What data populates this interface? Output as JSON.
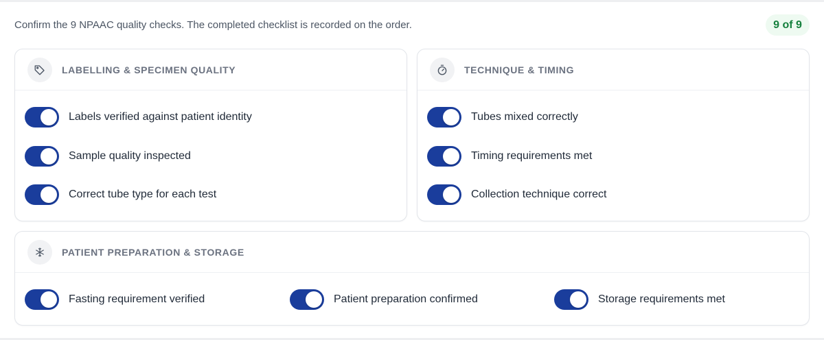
{
  "intro_text": "Confirm the 9 NPAAC quality checks. The completed checklist is recorded on the order.",
  "progress_badge": "9 of 9",
  "colors": {
    "toggle_on": "#1a3d9c",
    "badge_text": "#15803d",
    "badge_bg": "#eefaf1"
  },
  "sections": [
    {
      "icon": "tag-icon",
      "title": "LABELLING & SPECIMEN QUALITY",
      "items": [
        {
          "label": "Labels verified against patient identity",
          "checked": true
        },
        {
          "label": "Sample quality inspected",
          "checked": true
        },
        {
          "label": "Correct tube type for each test",
          "checked": true
        }
      ]
    },
    {
      "icon": "stopwatch-icon",
      "title": "TECHNIQUE & TIMING",
      "items": [
        {
          "label": "Tubes mixed correctly",
          "checked": true
        },
        {
          "label": "Timing requirements met",
          "checked": true
        },
        {
          "label": "Collection technique correct",
          "checked": true
        }
      ]
    },
    {
      "icon": "snowflake-icon",
      "title": "PATIENT PREPARATION & STORAGE",
      "items": [
        {
          "label": "Fasting requirement verified",
          "checked": true
        },
        {
          "label": "Patient preparation confirmed",
          "checked": true
        },
        {
          "label": "Storage requirements met",
          "checked": true
        }
      ]
    }
  ]
}
